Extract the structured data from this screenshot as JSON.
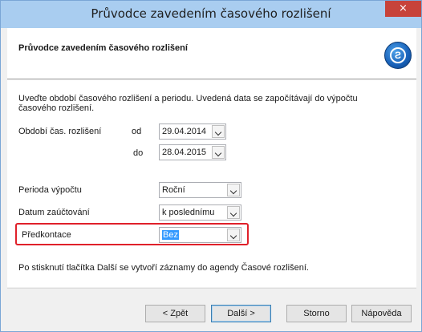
{
  "window": {
    "title": "Průvodce zavedením časového rozlišení",
    "close_glyph": "×"
  },
  "header": {
    "title": "Průvodce zavedením časového rozlišení",
    "logo_icon": "wizard-logo-icon",
    "logo_glyph": "Ƨ"
  },
  "main": {
    "description": "Uveďte období časového rozlišení a periodu. Uvedená data se započítávají do výpočtu časového rozlišení.",
    "period_label": "Období čas. rozlišení",
    "from_label": "od",
    "from_value": "29.04.2014",
    "to_label": "do",
    "to_value": "28.04.2015",
    "calc_period_label": "Perioda výpočtu",
    "calc_period_value": "Roční",
    "posting_date_label": "Datum zaúčtování",
    "posting_date_value": "k poslednímu",
    "precontation_label": "Předkontace",
    "precontation_value": "Bez",
    "footer_text": "Po stisknutí tlačítka Další se vytvoří záznamy do agendy Časové rozlišení."
  },
  "buttons": {
    "back": "< Zpět",
    "next": "Další >",
    "cancel": "Storno",
    "help": "Nápověda"
  },
  "colors": {
    "titlebar": "#a9cdf0",
    "close": "#c7433a",
    "highlight": "#e0202a",
    "selection": "#3399ff"
  }
}
